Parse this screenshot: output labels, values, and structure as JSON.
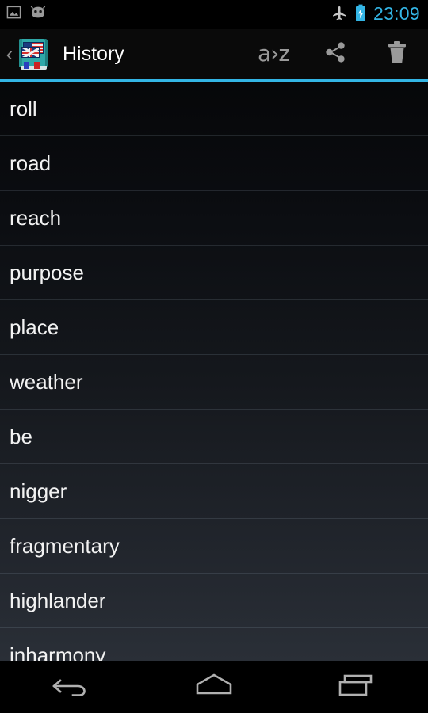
{
  "status_bar": {
    "left_icons": [
      {
        "name": "screenshot-image-icon",
        "glyph": "image"
      },
      {
        "name": "android-head-icon",
        "glyph": "android"
      }
    ],
    "right_icons": [
      {
        "name": "airplane-mode-icon",
        "glyph": "airplane"
      },
      {
        "name": "battery-charging-icon",
        "glyph": "battery-bolt"
      }
    ],
    "clock": "23:09",
    "clock_color": "#33b5e5"
  },
  "action_bar": {
    "up_chevron": "‹",
    "app_icon": "dictionary-book-icon",
    "title": "History",
    "actions": [
      {
        "name": "sort-alphabetical-button",
        "label": "a›z",
        "icon": "sort-az-icon"
      },
      {
        "name": "share-button",
        "label": "",
        "icon": "share-icon"
      },
      {
        "name": "delete-all-button",
        "label": "",
        "icon": "trash-icon"
      }
    ],
    "accent_color": "#33b5e5"
  },
  "list": {
    "items": [
      {
        "word": "roll"
      },
      {
        "word": "road"
      },
      {
        "word": "reach"
      },
      {
        "word": "purpose"
      },
      {
        "word": "place"
      },
      {
        "word": "weather"
      },
      {
        "word": "be"
      },
      {
        "word": "nigger"
      },
      {
        "word": "fragmentary"
      },
      {
        "word": "highlander"
      },
      {
        "word": "inharmony"
      }
    ]
  },
  "nav_bar": {
    "buttons": [
      {
        "name": "back-button",
        "icon": "back-arrow-icon"
      },
      {
        "name": "home-button",
        "icon": "home-icon"
      },
      {
        "name": "recents-button",
        "icon": "recents-icon"
      }
    ]
  }
}
